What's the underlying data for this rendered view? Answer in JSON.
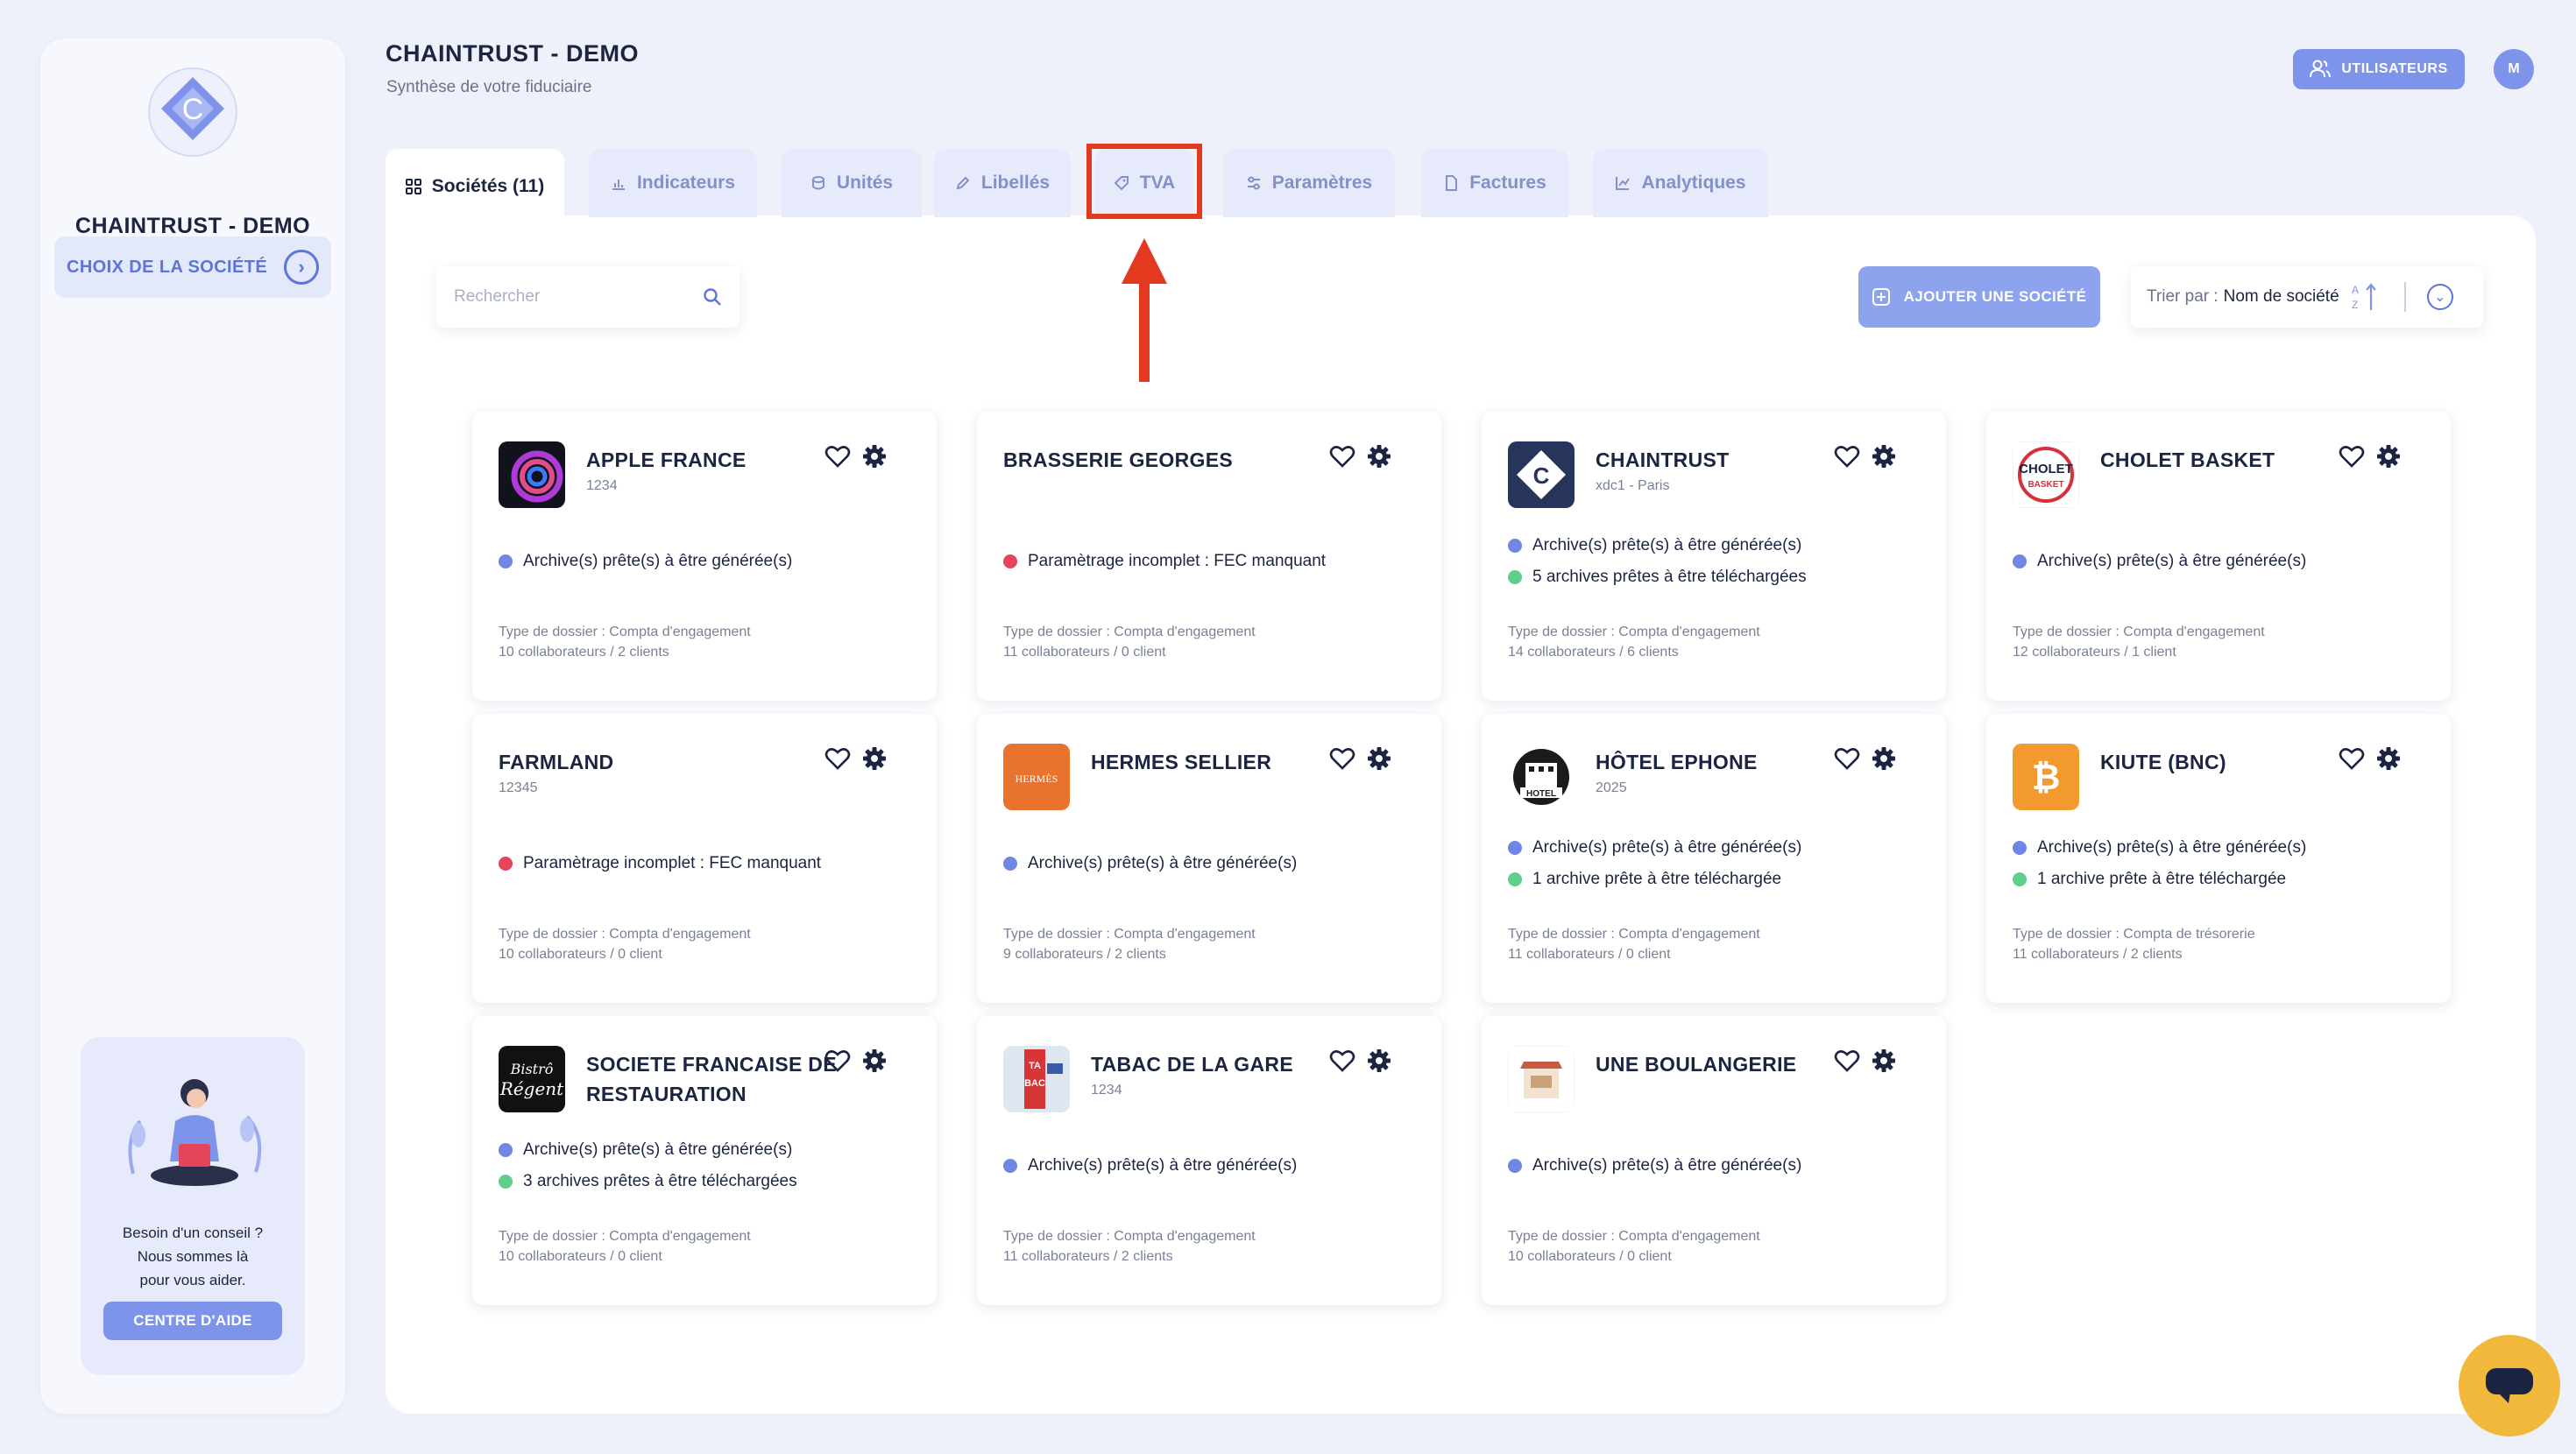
{
  "sidebar": {
    "org_name": "CHAINTRUST - DEMO",
    "choose_label": "CHOIX DE LA SOCIÉTÉ",
    "help": {
      "line1": "Besoin d'un conseil ?",
      "line2": "Nous sommes là",
      "line3": "pour vous aider.",
      "button": "CENTRE D'AIDE"
    }
  },
  "header": {
    "title": "CHAINTRUST - DEMO",
    "subtitle": "Synthèse de votre fiduciaire",
    "users_button": "UTILISATEURS",
    "avatar_initial": "M"
  },
  "tabs": [
    {
      "label": "Sociétés (11)",
      "icon": "grid-icon",
      "active": true
    },
    {
      "label": "Indicateurs",
      "icon": "bar-chart-icon"
    },
    {
      "label": "Unités",
      "icon": "coins-icon"
    },
    {
      "label": "Libellés",
      "icon": "pen-icon"
    },
    {
      "label": "TVA",
      "icon": "tag-icon"
    },
    {
      "label": "Paramètres",
      "icon": "sliders-icon"
    },
    {
      "label": "Factures",
      "icon": "file-icon"
    },
    {
      "label": "Analytiques",
      "icon": "line-chart-icon"
    }
  ],
  "toolbar": {
    "search_placeholder": "Rechercher",
    "add_button": "AJOUTER UNE SOCIÉTÉ",
    "sort_prefix": "Trier par :",
    "sort_value": "Nom de société"
  },
  "colors": {
    "accent": "#7d94ea",
    "status_blue": "#6f86e4",
    "status_red": "#e5455b",
    "status_green": "#5fcf8c",
    "annotation_red": "#e3391f",
    "chat": "#f1b83c"
  },
  "companies": [
    {
      "name": "APPLE FRANCE",
      "sub": "1234",
      "statuses": [
        {
          "text": "Archive(s) prête(s) à être générée(s)",
          "color": "blue"
        }
      ],
      "type_label": "Type de dossier :",
      "type": "Compta d'engagement",
      "counts": "10 collaborateurs / 2 clients"
    },
    {
      "name": "BRASSERIE GEORGES",
      "sub": "",
      "statuses": [
        {
          "text": "Paramètrage incomplet : FEC manquant",
          "color": "red"
        }
      ],
      "type_label": "Type de dossier :",
      "type": "Compta d'engagement",
      "counts": "11 collaborateurs / 0 client"
    },
    {
      "name": "CHAINTRUST",
      "sub": "xdc1 - Paris",
      "statuses": [
        {
          "text": "Archive(s) prête(s) à être générée(s)",
          "color": "blue"
        },
        {
          "text": "5 archives prêtes à être téléchargées",
          "color": "green"
        }
      ],
      "type_label": "Type de dossier :",
      "type": "Compta d'engagement",
      "counts": "14 collaborateurs / 6 clients"
    },
    {
      "name": "CHOLET BASKET",
      "sub": "",
      "statuses": [
        {
          "text": "Archive(s) prête(s) à être générée(s)",
          "color": "blue"
        }
      ],
      "type_label": "Type de dossier :",
      "type": "Compta d'engagement",
      "counts": "12 collaborateurs / 1 client"
    },
    {
      "name": "FARMLAND",
      "sub": "12345",
      "statuses": [
        {
          "text": "Paramètrage incomplet : FEC manquant",
          "color": "red"
        }
      ],
      "type_label": "Type de dossier :",
      "type": "Compta d'engagement",
      "counts": "10 collaborateurs / 0 client"
    },
    {
      "name": "HERMES SELLIER",
      "sub": "",
      "statuses": [
        {
          "text": "Archive(s) prête(s) à être générée(s)",
          "color": "blue"
        }
      ],
      "type_label": "Type de dossier :",
      "type": "Compta d'engagement",
      "counts": "9 collaborateurs / 2 clients"
    },
    {
      "name": "HÔTEL EPHONE",
      "sub": "2025",
      "statuses": [
        {
          "text": "Archive(s) prête(s) à être générée(s)",
          "color": "blue"
        },
        {
          "text": "1 archive prête à être téléchargée",
          "color": "green"
        }
      ],
      "type_label": "Type de dossier :",
      "type": "Compta d'engagement",
      "counts": "11 collaborateurs / 0 client"
    },
    {
      "name": "KIUTE (BNC)",
      "sub": "",
      "statuses": [
        {
          "text": "Archive(s) prête(s) à être générée(s)",
          "color": "blue"
        },
        {
          "text": "1 archive prête à être téléchargée",
          "color": "green"
        }
      ],
      "type_label": "Type de dossier :",
      "type": "Compta de trésorerie",
      "counts": "11 collaborateurs / 2 clients"
    },
    {
      "name": "SOCIETE FRANCAISE DE RESTAURATION",
      "sub": "",
      "statuses": [
        {
          "text": "Archive(s) prête(s) à être générée(s)",
          "color": "blue"
        },
        {
          "text": "3 archives prêtes à être téléchargées",
          "color": "green"
        }
      ],
      "type_label": "Type de dossier :",
      "type": "Compta d'engagement",
      "counts": "10 collaborateurs / 0 client"
    },
    {
      "name": "TABAC DE LA GARE",
      "sub": "1234",
      "statuses": [
        {
          "text": "Archive(s) prête(s) à être générée(s)",
          "color": "blue"
        }
      ],
      "type_label": "Type de dossier :",
      "type": "Compta d'engagement",
      "counts": "11 collaborateurs / 2 clients"
    },
    {
      "name": "UNE BOULANGERIE",
      "sub": "",
      "statuses": [
        {
          "text": "Archive(s) prête(s) à être générée(s)",
          "color": "blue"
        }
      ],
      "type_label": "Type de dossier :",
      "type": "Compta d'engagement",
      "counts": "10 collaborateurs / 0 client"
    }
  ]
}
